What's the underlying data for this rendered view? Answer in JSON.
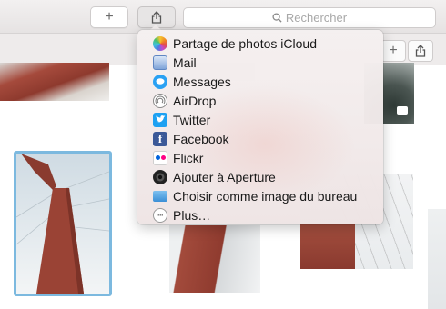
{
  "toolbar": {
    "add_icon": "plus-icon",
    "share_icon": "share-icon"
  },
  "search": {
    "placeholder": "Rechercher",
    "icon": "search-icon"
  },
  "subbar": {
    "add_icon": "plus-icon",
    "share_icon": "share-icon"
  },
  "share_menu": {
    "items": [
      {
        "label": "Partage de photos iCloud",
        "icon": "icloud-photos-icon"
      },
      {
        "label": "Mail",
        "icon": "mail-icon"
      },
      {
        "label": "Messages",
        "icon": "messages-icon"
      },
      {
        "label": "AirDrop",
        "icon": "airdrop-icon"
      },
      {
        "label": "Twitter",
        "icon": "twitter-icon"
      },
      {
        "label": "Facebook",
        "icon": "facebook-icon"
      },
      {
        "label": "Flickr",
        "icon": "flickr-icon"
      },
      {
        "label": "Ajouter à Aperture",
        "icon": "aperture-icon"
      },
      {
        "label": "Choisir comme image du bureau",
        "icon": "desktop-folder-icon"
      },
      {
        "label": "Plus…",
        "icon": "more-icon"
      }
    ]
  },
  "colors": {
    "selection_border": "#7cb9df",
    "twitter": "#1da1f2",
    "facebook": "#3b5998",
    "bridge_red": "#9a4335"
  }
}
